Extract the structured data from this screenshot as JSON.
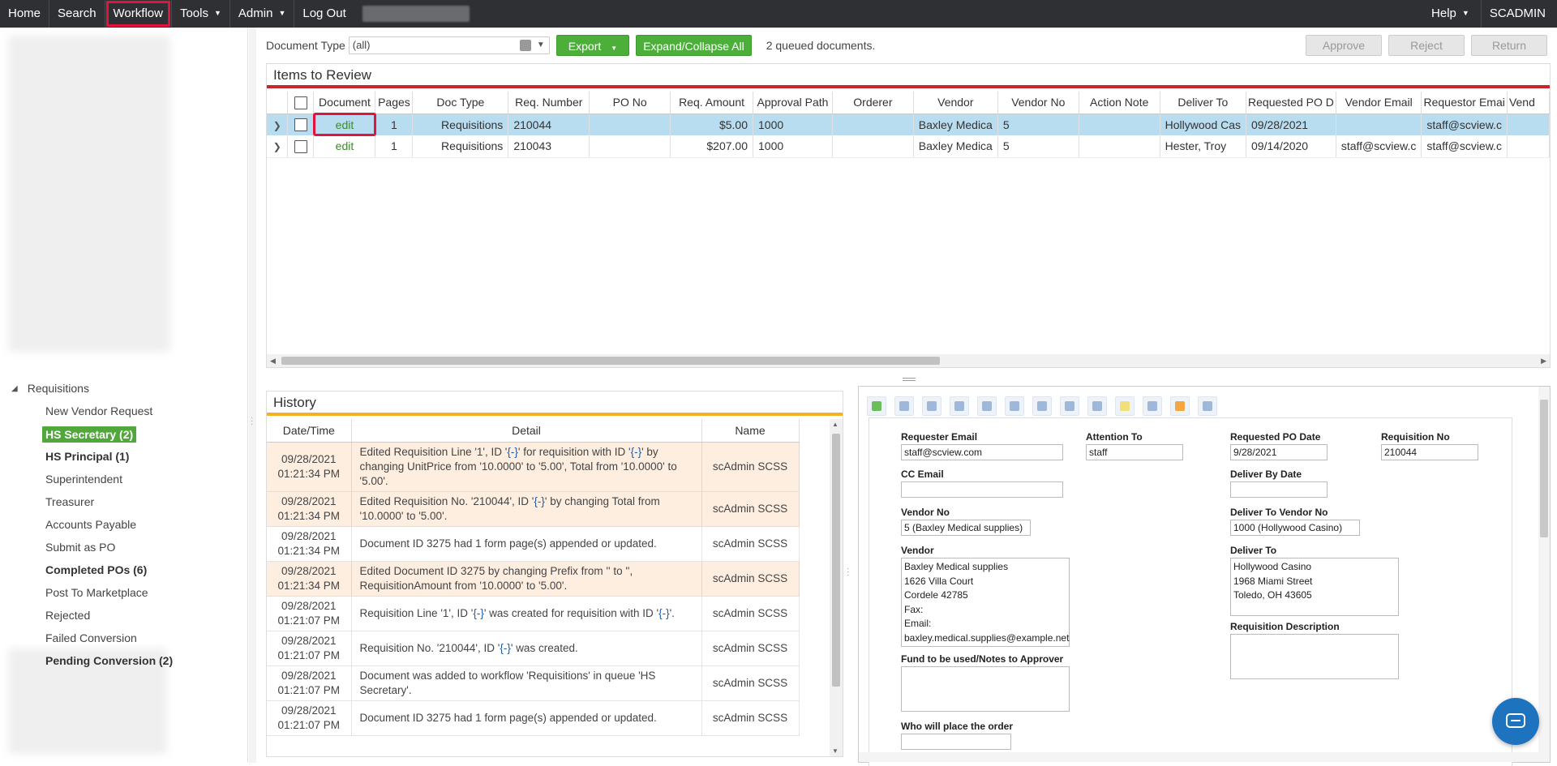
{
  "topnav": {
    "items": [
      "Home",
      "Search",
      "Workflow",
      "Tools",
      "Admin",
      "Log Out"
    ],
    "help": "Help",
    "user": "SCADMIN"
  },
  "sidebar": {
    "group": "Requisitions",
    "items": [
      {
        "label": "New Vendor Request",
        "bold": false,
        "active": false
      },
      {
        "label": "HS Secretary (2)",
        "bold": true,
        "active": true
      },
      {
        "label": "HS Principal (1)",
        "bold": true,
        "active": false
      },
      {
        "label": "Superintendent",
        "bold": false,
        "active": false
      },
      {
        "label": "Treasurer",
        "bold": false,
        "active": false
      },
      {
        "label": "Accounts Payable",
        "bold": false,
        "active": false
      },
      {
        "label": "Submit as PO",
        "bold": false,
        "active": false
      },
      {
        "label": "Completed POs (6)",
        "bold": true,
        "active": false
      },
      {
        "label": "Post To Marketplace",
        "bold": false,
        "active": false
      },
      {
        "label": "Rejected",
        "bold": false,
        "active": false
      },
      {
        "label": "Failed Conversion",
        "bold": false,
        "active": false
      },
      {
        "label": "Pending Conversion (2)",
        "bold": true,
        "active": false
      }
    ]
  },
  "toolbar": {
    "doc_type_label": "Document Type",
    "doc_type_value": "(all)",
    "export_label": "Export",
    "expand_label": "Expand/Collapse All",
    "queued_text": "2 queued documents.",
    "approve_label": "Approve",
    "reject_label": "Reject",
    "return_label": "Return"
  },
  "items": {
    "title": "Items to Review",
    "columns": [
      "Document",
      "Pages",
      "Doc Type",
      "Req. Number",
      "PO No",
      "Req. Amount",
      "Approval Path",
      "Orderer",
      "Vendor",
      "Vendor No",
      "Action Note",
      "Deliver To",
      "Requested PO D",
      "Vendor Email",
      "Requestor Emai",
      "Vend"
    ],
    "rows": [
      {
        "document": "edit",
        "pages": "1",
        "doc_type": "Requisitions",
        "req_number": "210044",
        "po_no": "",
        "amount": "$5.00",
        "approval_path": "1000",
        "orderer": "",
        "vendor": "Baxley Medica",
        "vendor_no": "5",
        "action_note": "",
        "deliver_to": "Hollywood Cas",
        "req_po_date": "09/28/2021",
        "vendor_email": "",
        "requestor_email": "staff@scview.c"
      },
      {
        "document": "edit",
        "pages": "1",
        "doc_type": "Requisitions",
        "req_number": "210043",
        "po_no": "",
        "amount": "$207.00",
        "approval_path": "1000",
        "orderer": "",
        "vendor": "Baxley Medica",
        "vendor_no": "5",
        "action_note": "",
        "deliver_to": "Hester, Troy",
        "req_po_date": "09/14/2020",
        "vendor_email": "staff@scview.c",
        "requestor_email": "staff@scview.c"
      }
    ]
  },
  "history": {
    "title": "History",
    "columns": [
      "Date/Time",
      "Detail",
      "Name"
    ],
    "rows": [
      {
        "date": "09/28/2021",
        "time": "01:21:34 PM",
        "detail_parts": [
          "Edited Requisition Line '1', ID '",
          "{-}",
          "' for requisition with ID '",
          "{-}",
          "' by changing UnitPrice from '10.0000' to '5.00', Total from '10.0000' to '5.00'."
        ],
        "name": "scAdmin SCSS",
        "style": "org"
      },
      {
        "date": "09/28/2021",
        "time": "01:21:34 PM",
        "detail_parts": [
          "Edited Requisition No. '210044', ID '",
          "{-}",
          "' by changing Total from '10.0000' to '5.00'."
        ],
        "name": "scAdmin SCSS",
        "style": "org"
      },
      {
        "date": "09/28/2021",
        "time": "01:21:34 PM",
        "detail_parts": [
          "Document ID 3275 had 1 form page(s) appended or updated."
        ],
        "name": "scAdmin SCSS",
        "style": "wht"
      },
      {
        "date": "09/28/2021",
        "time": "01:21:34 PM",
        "detail_parts": [
          "Edited Document ID 3275 by changing Prefix from '' to '', RequisitionAmount from '10.0000' to '5.00'."
        ],
        "name": "scAdmin SCSS",
        "style": "org"
      },
      {
        "date": "09/28/2021",
        "time": "01:21:07 PM",
        "detail_parts": [
          "Requisition Line '1', ID '",
          "{-}",
          "' was created for requisition with ID '",
          "{-}",
          "'."
        ],
        "name": "scAdmin SCSS",
        "style": "wht"
      },
      {
        "date": "09/28/2021",
        "time": "01:21:07 PM",
        "detail_parts": [
          "Requisition No. '210044', ID '",
          "{-}",
          "' was created."
        ],
        "name": "scAdmin SCSS",
        "style": "wht"
      },
      {
        "date": "09/28/2021",
        "time": "01:21:07 PM",
        "detail_parts": [
          "Document was added to workflow 'Requisitions' in queue 'HS Secretary'."
        ],
        "name": "scAdmin SCSS",
        "style": "wht"
      },
      {
        "date": "09/28/2021",
        "time": "01:21:07 PM",
        "detail_parts": [
          "Document ID 3275 had 1 form page(s) appended or updated."
        ],
        "name": "scAdmin SCSS",
        "style": "wht"
      }
    ]
  },
  "form": {
    "requester_email_label": "Requester Email",
    "requester_email": "staff@scview.com",
    "attention_to_label": "Attention To",
    "attention_to": "staff",
    "requested_po_date_label": "Requested PO Date",
    "requested_po_date": "9/28/2021",
    "requisition_no_label": "Requisition No",
    "requisition_no": "210044",
    "cc_email_label": "CC Email",
    "cc_email": "",
    "deliver_by_date_label": "Deliver By Date",
    "deliver_by_date": "",
    "vendor_no_label": "Vendor No",
    "vendor_no": "5 (Baxley Medical supplies)",
    "deliver_to_vendor_no_label": "Deliver To Vendor No",
    "deliver_to_vendor_no": "1000 (Hollywood Casino)",
    "vendor_label": "Vendor",
    "vendor": "Baxley Medical supplies\n1626 Villa Court\nCordele 42785\nFax:\nEmail:\nbaxley.medical.supplies@example.net",
    "deliver_to_label": "Deliver To",
    "deliver_to": "Hollywood Casino\n1968 Miami Street\nToledo, OH 43605",
    "requisition_description_label": "Requisition Description",
    "fund_label": "Fund to be used/Notes to Approver",
    "who_label": "Who will place the order"
  },
  "icons": [
    "add-page-icon",
    "print-icon",
    "zoom-in-icon",
    "zoom-out-icon",
    "fit-icon",
    "rotate-left-icon",
    "rotate-right-icon",
    "flip-icon",
    "text-icon",
    "note-icon",
    "stamp-icon",
    "highlight-icon",
    "edit-form-icon"
  ],
  "colors": {
    "accent_green": "#4caf3a",
    "items_bar": "#c8252c",
    "history_bar": "#f3b222",
    "selected_row": "#b8dcf0",
    "highlight_box": "#e0143c"
  }
}
